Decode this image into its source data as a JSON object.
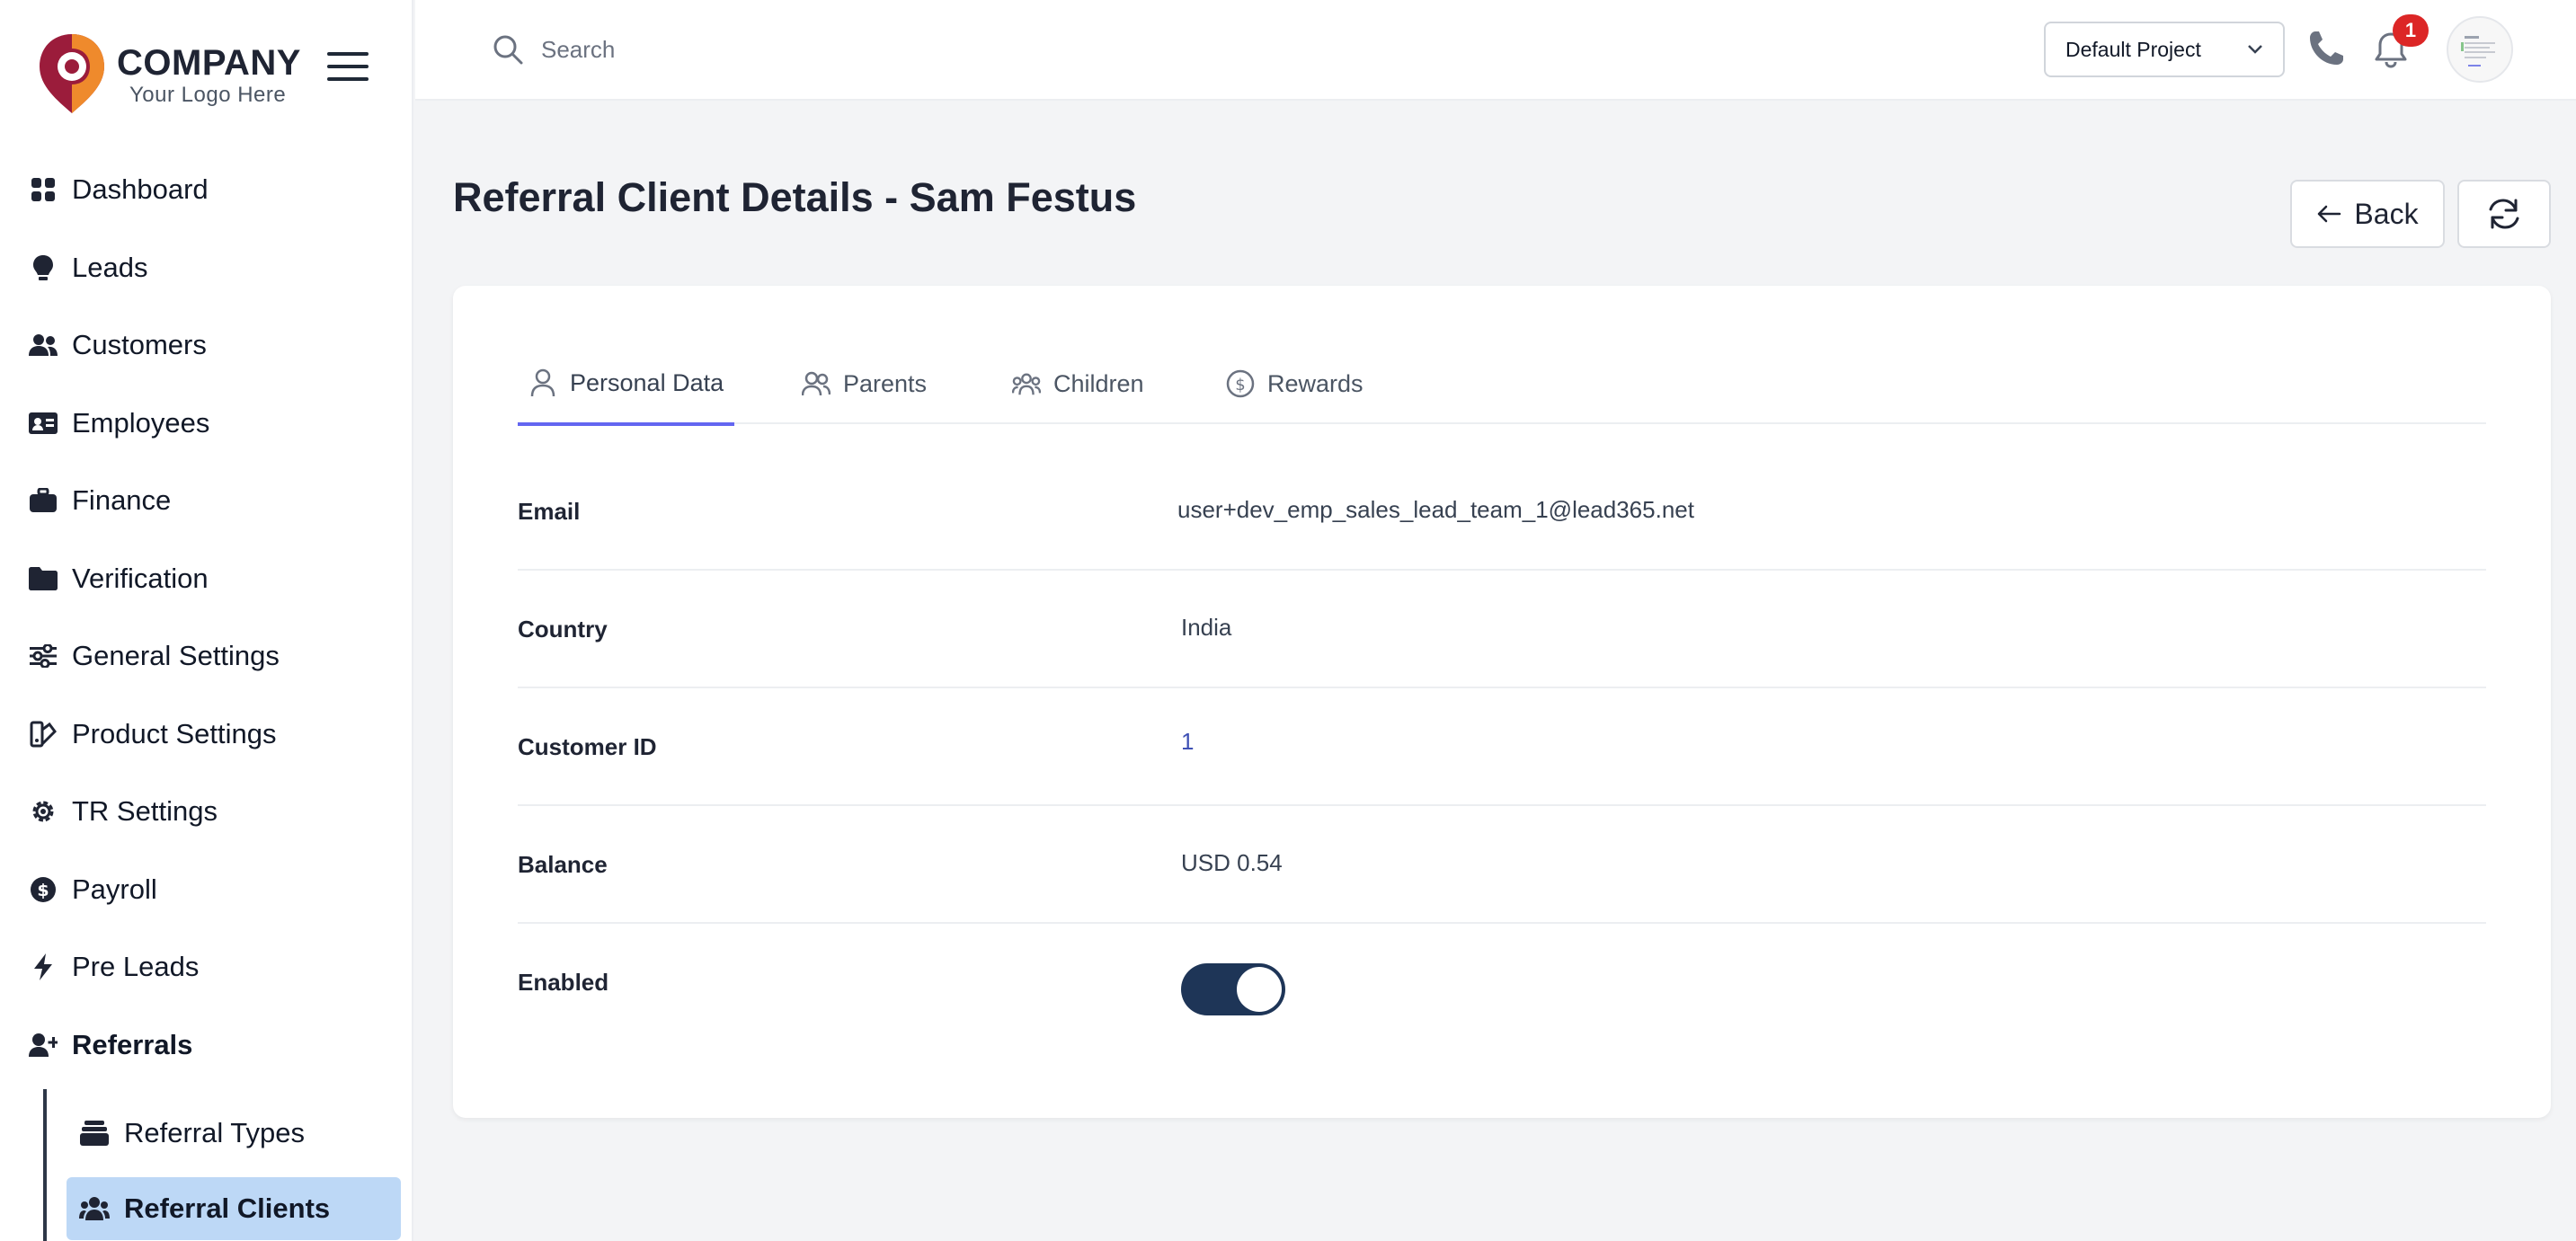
{
  "brand": {
    "name": "COMPANY",
    "tagline": "Your Logo Here"
  },
  "sidebar": {
    "items": [
      {
        "label": "Dashboard",
        "icon": "dashboard-icon"
      },
      {
        "label": "Leads",
        "icon": "lightbulb-icon"
      },
      {
        "label": "Customers",
        "icon": "users-icon"
      },
      {
        "label": "Employees",
        "icon": "id-card-icon"
      },
      {
        "label": "Finance",
        "icon": "briefcase-icon"
      },
      {
        "label": "Verification",
        "icon": "folder-icon"
      },
      {
        "label": "General Settings",
        "icon": "sliders-icon"
      },
      {
        "label": "Product Settings",
        "icon": "palette-icon"
      },
      {
        "label": "TR Settings",
        "icon": "gear-icon"
      },
      {
        "label": "Payroll",
        "icon": "dollar-circle-icon"
      },
      {
        "label": "Pre Leads",
        "icon": "bolt-icon"
      },
      {
        "label": "Referrals",
        "icon": "user-plus-icon"
      }
    ],
    "sub_items": [
      {
        "label": "Referral Types",
        "icon": "layers-icon"
      },
      {
        "label": "Referral Clients",
        "icon": "users-icon"
      }
    ]
  },
  "header": {
    "search_placeholder": "Search",
    "project": "Default Project",
    "notification_count": "1"
  },
  "page": {
    "title": "Referral Client Details - Sam Festus",
    "back_label": "Back"
  },
  "tabs": [
    {
      "label": "Personal Data",
      "icon": "user-icon"
    },
    {
      "label": "Parents",
      "icon": "users-icon"
    },
    {
      "label": "Children",
      "icon": "group-icon"
    },
    {
      "label": "Rewards",
      "icon": "dollar-circle-icon"
    }
  ],
  "details": {
    "email": {
      "label": "Email",
      "value": "user+dev_emp_sales_lead_team_1@lead365.net"
    },
    "country": {
      "label": "Country",
      "value": "India"
    },
    "customer_id": {
      "label": "Customer ID",
      "value": "1"
    },
    "balance": {
      "label": "Balance",
      "value": "USD 0.54"
    },
    "enabled": {
      "label": "Enabled",
      "value": true
    }
  },
  "colors": {
    "accent": "#6366f1",
    "toggle_on": "#1e3557",
    "selected_nav": "#bdd8f6",
    "badge": "#dc2626"
  }
}
